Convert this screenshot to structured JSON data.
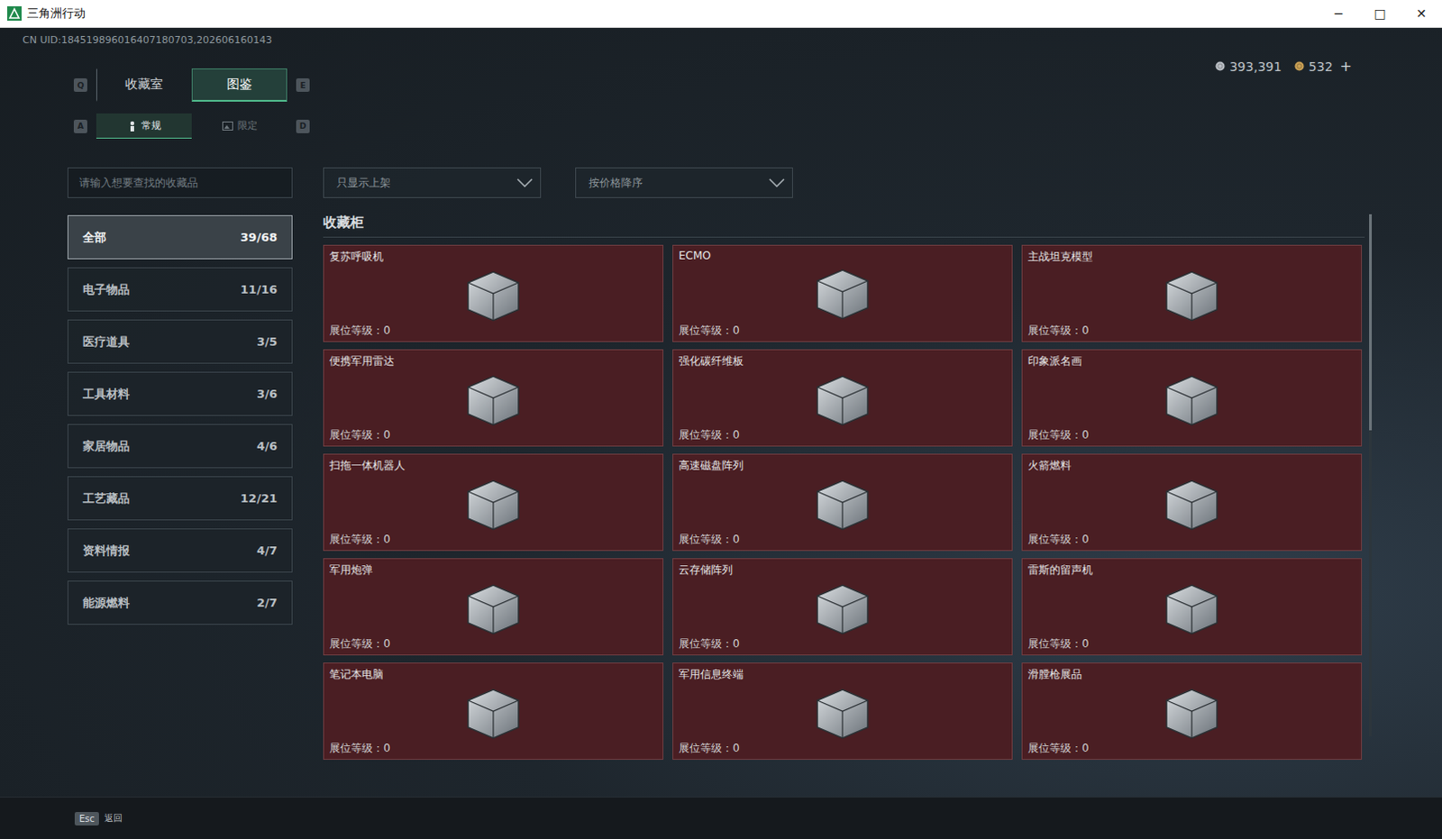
{
  "window": {
    "title": "三角洲行动",
    "controls": [
      "─",
      "□",
      "✕"
    ]
  },
  "uid": "CN UID:184519896016407180703,202606160143",
  "currency": {
    "items": [
      {
        "amount": "393,391",
        "color": "#b9bec4"
      },
      {
        "amount": "532",
        "color": "#c9a055"
      }
    ],
    "add": "+"
  },
  "tabs": {
    "prev_key": "Q",
    "next_key": "E",
    "items": [
      {
        "label": "收藏室",
        "selected": false
      },
      {
        "label": "图鉴",
        "selected": true
      }
    ]
  },
  "subtabs": {
    "prev_key": "A",
    "next_key": "D",
    "items": [
      {
        "label": "常规",
        "selected": true
      },
      {
        "label": "限定",
        "selected": false
      }
    ]
  },
  "search": {
    "placeholder": "请输入想要查找的收藏品"
  },
  "filters": [
    {
      "label": "只显示上架"
    },
    {
      "label": "按价格降序"
    }
  ],
  "sidebar": {
    "items": [
      {
        "label": "全部",
        "count": "39/68",
        "selected": true
      },
      {
        "label": "电子物品",
        "count": "11/16",
        "selected": false
      },
      {
        "label": "医疗道具",
        "count": "3/5",
        "selected": false
      },
      {
        "label": "工具材料",
        "count": "3/6",
        "selected": false
      },
      {
        "label": "家居物品",
        "count": "4/6",
        "selected": false
      },
      {
        "label": "工艺藏品",
        "count": "12/21",
        "selected": false
      },
      {
        "label": "资料情报",
        "count": "4/7",
        "selected": false
      },
      {
        "label": "能源燃料",
        "count": "2/7",
        "selected": false
      }
    ]
  },
  "section_title": "收藏柜",
  "cards": [
    {
      "name": "复苏呼吸机",
      "level_text": "展位等级：0"
    },
    {
      "name": "ECMO",
      "level_text": "展位等级：0"
    },
    {
      "name": "主战坦克模型",
      "level_text": "展位等级：0"
    },
    {
      "name": "便携军用雷达",
      "level_text": "展位等级：0"
    },
    {
      "name": "强化碳纤维板",
      "level_text": "展位等级：0"
    },
    {
      "name": "印象派名画",
      "level_text": "展位等级：0"
    },
    {
      "name": "扫拖一体机器人",
      "level_text": "展位等级：0"
    },
    {
      "name": "高速磁盘阵列",
      "level_text": "展位等级：0"
    },
    {
      "name": "火箭燃料",
      "level_text": "展位等级：0"
    },
    {
      "name": "军用炮弹",
      "level_text": "展位等级：0"
    },
    {
      "name": "云存储阵列",
      "level_text": "展位等级：0"
    },
    {
      "name": "雷斯的留声机",
      "level_text": "展位等级：0"
    },
    {
      "name": "笔记本电脑",
      "level_text": "展位等级：0"
    },
    {
      "name": "军用信息终端",
      "level_text": "展位等级：0"
    },
    {
      "name": "滑膛枪展品",
      "level_text": "展位等级：0"
    }
  ],
  "footer": {
    "key": "Esc",
    "label": "返回"
  }
}
